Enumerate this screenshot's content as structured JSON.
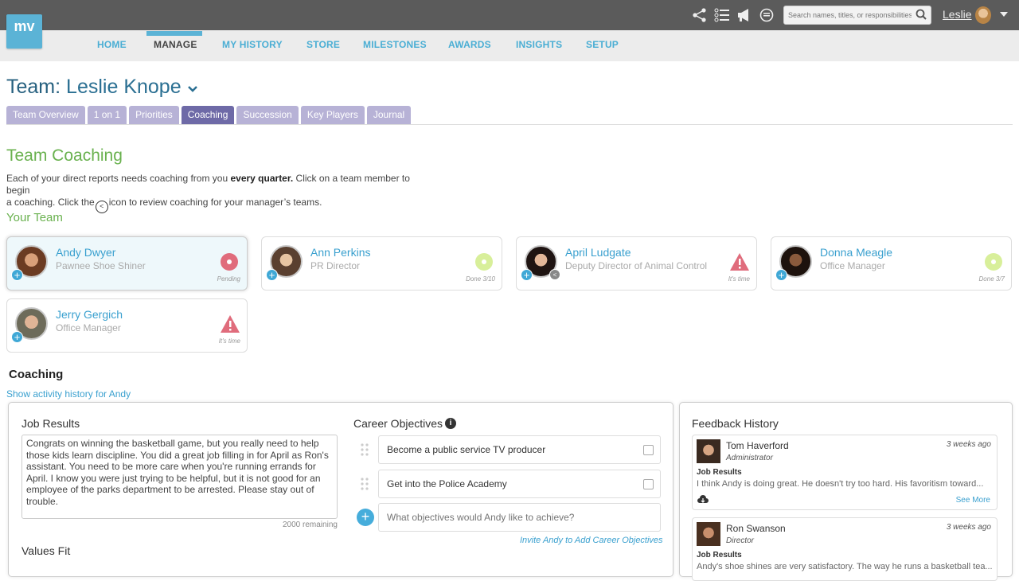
{
  "app": {
    "logo_text": "mv",
    "user_name": "Leslie",
    "search_placeholder": "Search names, titles, or responsibilities"
  },
  "nav": {
    "items": [
      "HOME",
      "MANAGE",
      "MY HISTORY",
      "STORE",
      "MILESTONES",
      "AWARDS",
      "INSIGHTS",
      "SETUP"
    ],
    "active": "MANAGE"
  },
  "header": {
    "team_prefix": "Team:",
    "team_name": "Leslie Knope"
  },
  "tabs": [
    "Team Overview",
    "1 on 1",
    "Priorities",
    "Coaching",
    "Succession",
    "Key Players",
    "Journal"
  ],
  "active_tab": "Coaching",
  "coaching": {
    "title": "Team Coaching",
    "intro_1": "Each of your direct reports needs coaching from you ",
    "intro_bold": "every quarter.",
    "intro_2": " Click on a team member to begin",
    "intro_3": "a coaching. Click the",
    "intro_4": "icon to review coaching for your manager’s teams.",
    "your_team_label": "Your Team"
  },
  "members": [
    {
      "name": "Andy Dwyer",
      "title": "Pawnee Shoe Shiner",
      "status": "Pending",
      "status_icon": "pending-icon",
      "selected": true
    },
    {
      "name": "Ann Perkins",
      "title": "PR Director",
      "status": "Done 3/10",
      "status_icon": "done-icon"
    },
    {
      "name": "April Ludgate",
      "title": "Deputy Director of Animal Control",
      "status": "It's time",
      "status_icon": "warning-icon"
    },
    {
      "name": "Donna Meagle",
      "title": "Office Manager",
      "status": "Done 3/7",
      "status_icon": "done-icon"
    },
    {
      "name": "Jerry Gergich",
      "title": "Office Manager",
      "status": "It's time",
      "status_icon": "warning-icon"
    }
  ],
  "coaching_section": {
    "title": "Coaching",
    "history_link": "Show activity history for Andy"
  },
  "job_results": {
    "title": "Job Results",
    "text": "Congrats on winning the basketball game, but you really need to help those kids learn discipline. You did a great job filling in for April as Ron's assistant. You need to be more care when you're running errands for April. I know you were just trying to be helpful, but it is not good for an employee of the parks department to be arrested. Please stay out of trouble.",
    "remaining": "2000 remaining",
    "values_fit_title": "Values Fit"
  },
  "career": {
    "title": "Career Objectives",
    "objectives": [
      "Become a public service TV producer",
      "Get into the Police Academy"
    ],
    "input_placeholder": "What objectives would Andy like to achieve?",
    "invite_link": "Invite Andy to Add Career Objectives"
  },
  "feedback": {
    "title": "Feedback History",
    "items": [
      {
        "name": "Tom Haverford",
        "role": "Administrator",
        "time": "3 weeks ago",
        "section": "Job Results",
        "text": "I think Andy is doing great. He doesn't try too hard. His favoritism toward...",
        "see_more": "See More"
      },
      {
        "name": "Ron Swanson",
        "role": "Director",
        "time": "3 weeks ago",
        "section": "Job Results",
        "text": "Andy's shoe shines are very satisfactory. The way he runs a basketball tea..."
      }
    ]
  },
  "colors": {
    "accent": "#5bb3d6",
    "green": "#69b14e",
    "tab": "#b7b2d6",
    "tab_active": "#6e6aa7",
    "warning": "#e06c7c",
    "done": "#d8ef9a"
  }
}
